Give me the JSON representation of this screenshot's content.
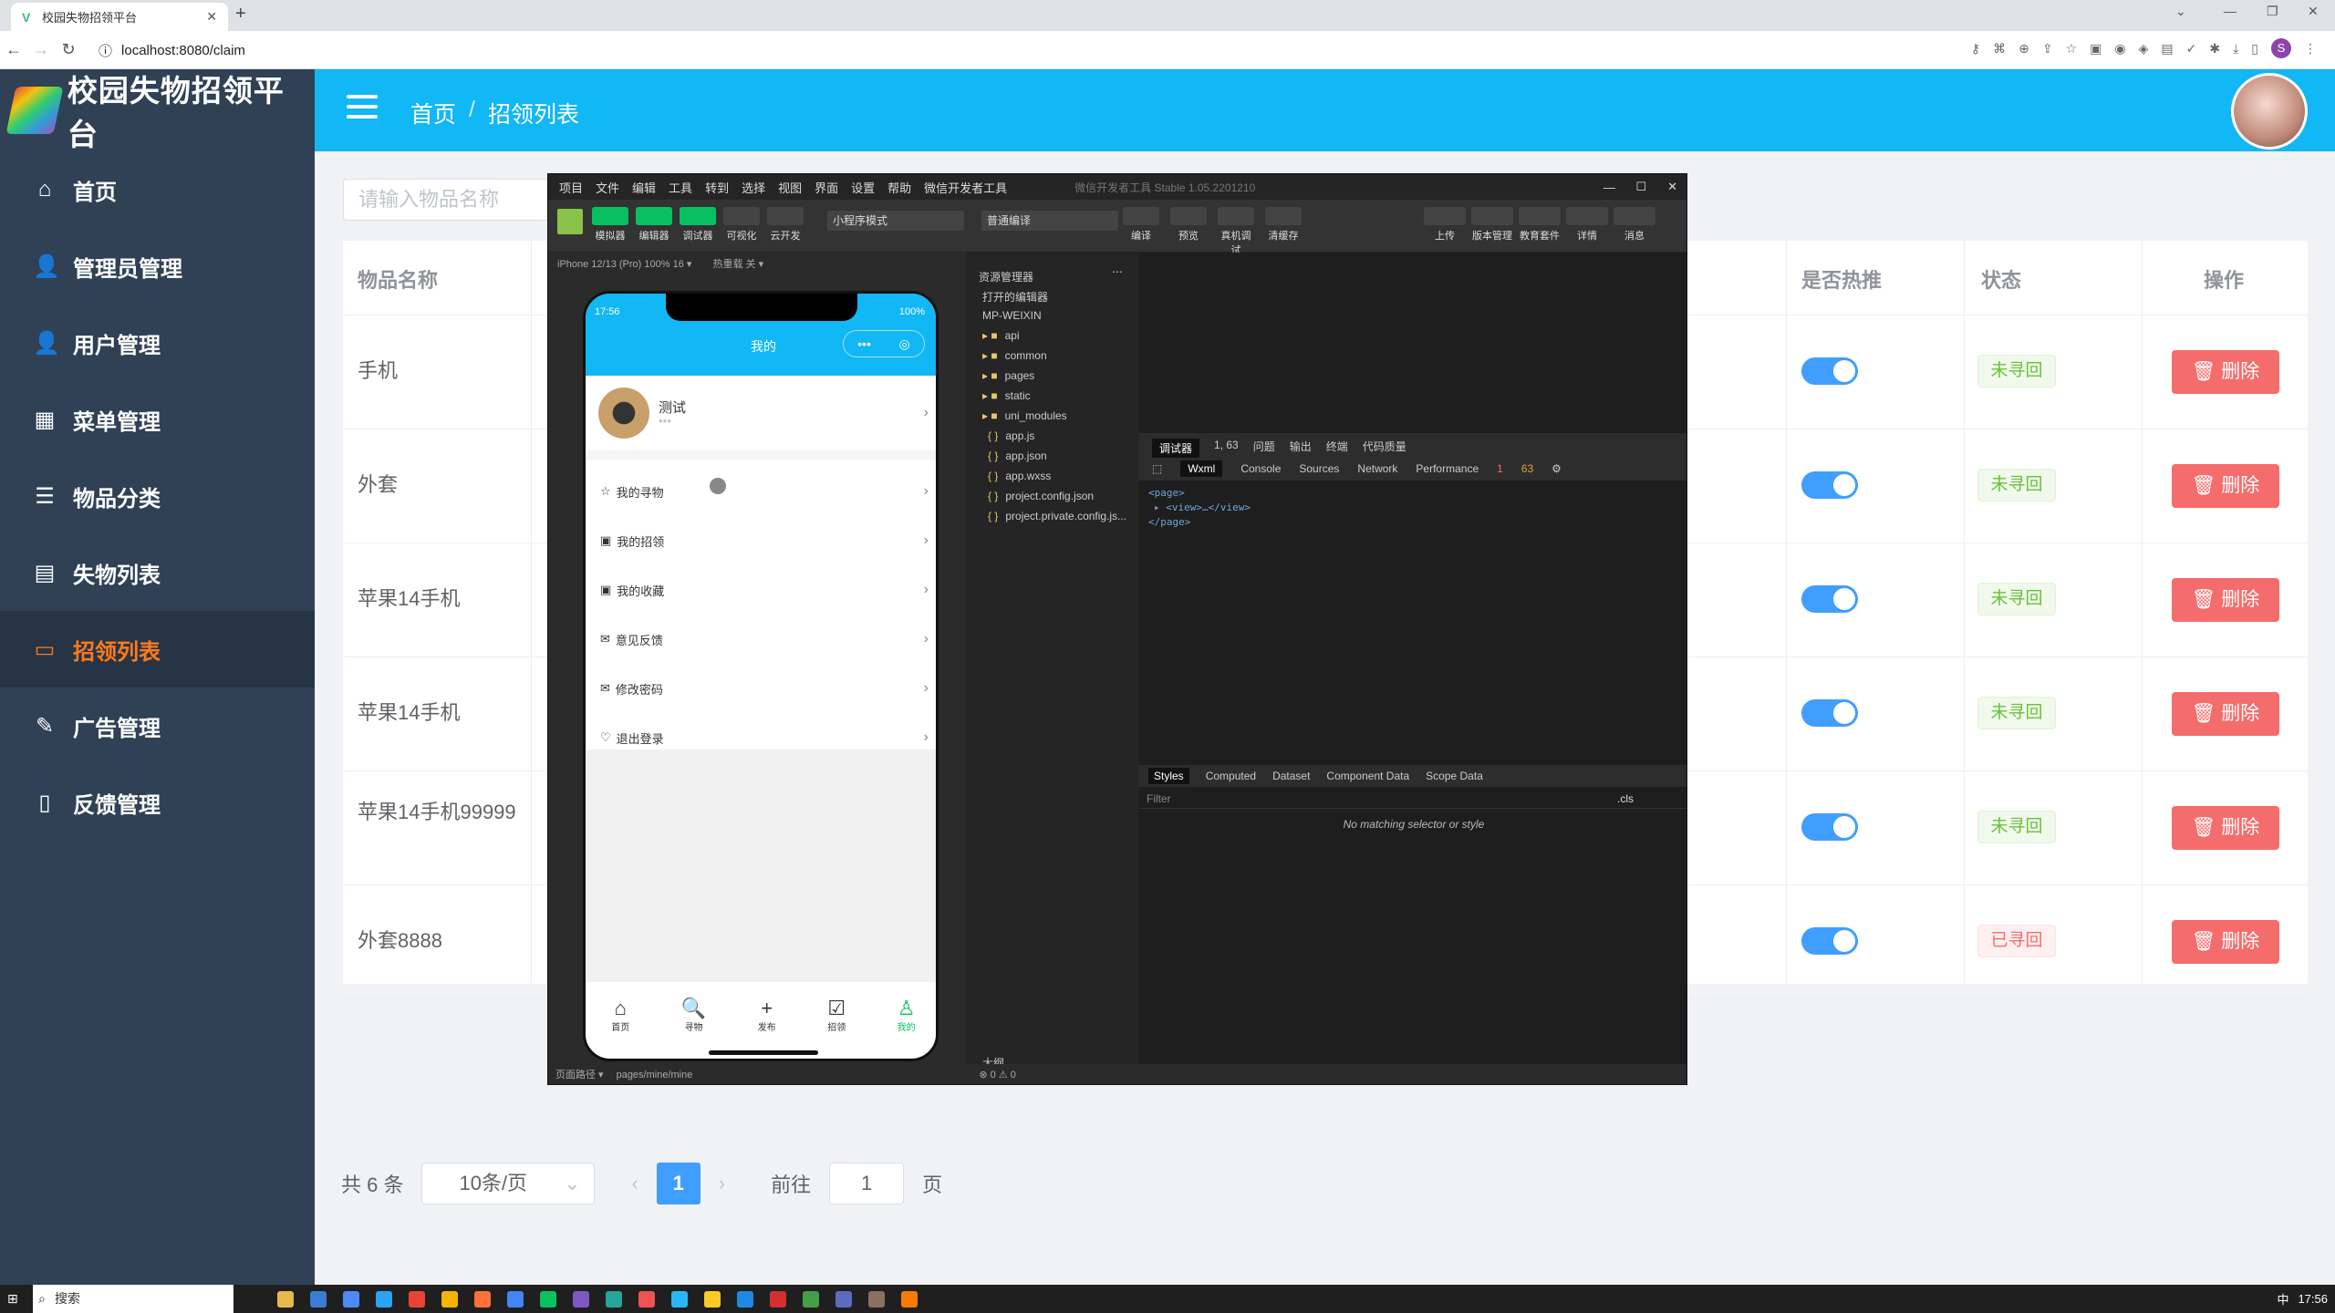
{
  "browser": {
    "tab_title": "校园失物招领平台",
    "url": "localhost:8080/claim"
  },
  "app": {
    "title": "校园失物招领平台"
  },
  "sidebar": {
    "items": [
      {
        "label": "首页",
        "icon": "home-icon"
      },
      {
        "label": "管理员管理",
        "icon": "user-icon"
      },
      {
        "label": "用户管理",
        "icon": "user-icon"
      },
      {
        "label": "菜单管理",
        "icon": "grid-icon"
      },
      {
        "label": "物品分类",
        "icon": "sliders-icon"
      },
      {
        "label": "失物列表",
        "icon": "list-icon"
      },
      {
        "label": "招领列表",
        "icon": "monitor-icon",
        "active": true
      },
      {
        "label": "广告管理",
        "icon": "edit-icon"
      },
      {
        "label": "反馈管理",
        "icon": "document-icon"
      }
    ]
  },
  "header": {
    "breadcrumb": [
      "首页",
      "招领列表"
    ],
    "separator": "/"
  },
  "search": {
    "placeholder": "请输入物品名称"
  },
  "table": {
    "headers": {
      "name": "物品名称",
      "hot": "是否热推",
      "status": "状态",
      "action": "操作"
    },
    "rows": [
      {
        "name": "手机",
        "hot": true,
        "status": "未寻回",
        "status_type": "success",
        "action": "删除"
      },
      {
        "name": "外套",
        "hot": true,
        "status": "未寻回",
        "status_type": "success",
        "action": "删除"
      },
      {
        "name": "苹果14手机",
        "hot": true,
        "status": "未寻回",
        "status_type": "success",
        "action": "删除"
      },
      {
        "name": "苹果14手机",
        "hot": true,
        "status": "未寻回",
        "status_type": "success",
        "action": "删除"
      },
      {
        "name": "苹果14手机99999",
        "hot": true,
        "status": "未寻回",
        "status_type": "success",
        "action": "删除"
      },
      {
        "name": "外套8888",
        "hot": true,
        "status": "已寻回",
        "status_type": "danger",
        "action": "删除"
      }
    ]
  },
  "pagination": {
    "total": "共 6 条",
    "page_size": "10条/页",
    "current": "1",
    "goto_prefix": "前往",
    "goto_value": "1",
    "goto_suffix": "页"
  },
  "devtools": {
    "window_title": "微信开发者工具 Stable 1.05.2201210",
    "menu": [
      "项目",
      "文件",
      "编辑",
      "工具",
      "转到",
      "选择",
      "视图",
      "界面",
      "设置",
      "帮助",
      "微信开发者工具"
    ],
    "toolbar": [
      "模拟器",
      "编辑器",
      "调试器",
      "可视化",
      "云开发"
    ],
    "toolbar_right": [
      "上传",
      "版本管理",
      "教育套件",
      "详情",
      "消息"
    ],
    "mode_select": "小程序模式",
    "compile_select": "普通编译",
    "compile_buttons": [
      "编译",
      "预览",
      "真机调试",
      "清缓存"
    ],
    "device": "iPhone 12/13 (Pro) 100% 16 ▾",
    "hot_reload": "热重载 关 ▾",
    "explorer_title": "资源管理器",
    "open_editors": "打开的编辑器",
    "project": "MP-WEIXIN",
    "files": [
      "api",
      "common",
      "pages",
      "static",
      "uni_modules",
      "app.js",
      "app.json",
      "app.wxss",
      "project.config.json",
      "project.private.config.js..."
    ],
    "outline": "大纲",
    "debug_tabs": [
      "调试器",
      "1, 63",
      "问题",
      "输出",
      "终端",
      "代码质量"
    ],
    "panel_tabs": [
      "Wxml",
      "Console",
      "Sources",
      "Network",
      "Performance"
    ],
    "errors": "1",
    "warnings": "63",
    "code": [
      "<page>",
      "▸ <view>…</view>",
      "</page>"
    ],
    "style_tabs": [
      "Styles",
      "Computed",
      "Dataset",
      "Component Data",
      "Scope Data"
    ],
    "filter_placeholder": "Filter",
    "cls": ".cls",
    "no_match": "No matching selector or style",
    "status_path_label": "页面路径 ▾",
    "status_path": "pages/mine/mine",
    "status_counts": "⊗ 0 ⚠ 0"
  },
  "phone": {
    "time": "17:56",
    "battery": "100%",
    "title": "我的",
    "user_name": "测试",
    "user_sub": "***",
    "menu": [
      {
        "label": "我的寻物",
        "icon": "star-icon"
      },
      {
        "label": "我的招领",
        "icon": "image-icon"
      },
      {
        "label": "我的收藏",
        "icon": "image-icon"
      },
      {
        "label": "意见反馈",
        "icon": "mail-icon"
      },
      {
        "label": "修改密码",
        "icon": "mail-icon"
      },
      {
        "label": "退出登录",
        "icon": "heart-icon"
      }
    ],
    "tabs": [
      {
        "label": "首页",
        "glyph": "⌂"
      },
      {
        "label": "寻物",
        "glyph": "🔍"
      },
      {
        "label": "发布",
        "glyph": "+"
      },
      {
        "label": "招领",
        "glyph": "☑"
      },
      {
        "label": "我的",
        "glyph": "♙",
        "active": true
      }
    ]
  },
  "taskbar": {
    "search": "搜索",
    "time": "17:56",
    "ime": "中"
  }
}
